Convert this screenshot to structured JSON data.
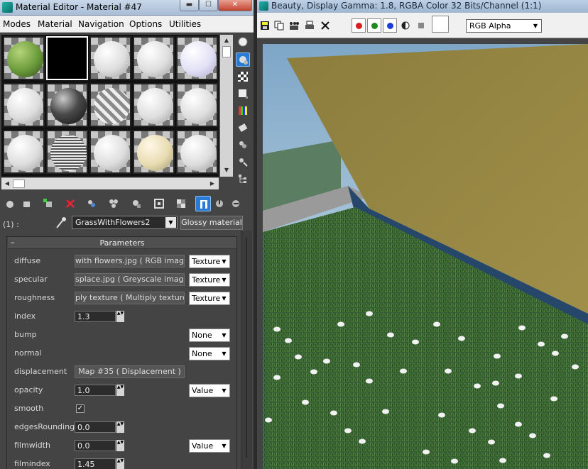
{
  "material_editor": {
    "title": "Material Editor - Material #47",
    "window_buttons": {
      "minimize": "▬",
      "maximize": "☐",
      "close": "✕"
    },
    "menu": [
      "Modes",
      "Material",
      "Navigation",
      "Options",
      "Utilities"
    ],
    "slots": [
      {
        "kind": "grass",
        "selected": false
      },
      {
        "kind": "black",
        "selected": true
      },
      {
        "kind": "white",
        "selected": false
      },
      {
        "kind": "white",
        "selected": false
      },
      {
        "kind": "lavender",
        "selected": false
      },
      {
        "kind": "white",
        "selected": false
      },
      {
        "kind": "dark",
        "selected": false
      },
      {
        "kind": "checker",
        "selected": false
      },
      {
        "kind": "white",
        "selected": false
      },
      {
        "kind": "white",
        "selected": false
      },
      {
        "kind": "white",
        "selected": false
      },
      {
        "kind": "striped",
        "selected": false
      },
      {
        "kind": "white",
        "selected": false
      },
      {
        "kind": "cream",
        "selected": false
      },
      {
        "kind": "white",
        "selected": false
      }
    ],
    "slot_label": "(1) :",
    "material_name": "GrassWithFlowers2",
    "material_type": "Glossy material",
    "rollout": {
      "toggle": "–",
      "title": "Parameters"
    },
    "params": {
      "diffuse": {
        "label": "diffuse",
        "map": "with flowers.jpg  ( RGB image )",
        "mode": "Texture"
      },
      "specular": {
        "label": "specular",
        "map": "splace.jpg  ( Greyscale image )",
        "mode": "Texture"
      },
      "roughness": {
        "label": "roughness",
        "map": "ply texture  ( Multiply texture )",
        "mode": "Texture"
      },
      "index": {
        "label": "index",
        "value": "1.3"
      },
      "bump": {
        "label": "bump",
        "mode": "None"
      },
      "normal": {
        "label": "normal",
        "mode": "None"
      },
      "displacement": {
        "label": "displacement",
        "map": "Map #35  ( Displacement )"
      },
      "opacity": {
        "label": "opacity",
        "value": "1.0",
        "mode": "Value"
      },
      "smooth": {
        "label": "smooth",
        "check": "✓"
      },
      "edgesRounding": {
        "label": "edgesRounding",
        "value": "0.0"
      },
      "filmwidth": {
        "label": "filmwidth",
        "value": "0.0",
        "mode": "Value"
      },
      "filmindex": {
        "label": "filmindex",
        "value": "1.45"
      }
    }
  },
  "frame_buffer": {
    "title": "Beauty, Display Gamma: 1.8, RGBA Color 32 Bits/Channel (1:1)",
    "channels": {
      "red": "#d81e1e",
      "green": "#1c8a1c",
      "blue": "#1e3ed8"
    },
    "channel_mode": "RGB Alpha"
  },
  "arrows": {
    "down": "▼",
    "up": "▲",
    "left": "◀",
    "right": "▶",
    "spin": "▲▼"
  },
  "icons": [
    "sphere-icon",
    "backlight-icon",
    "background-checker-icon",
    "sample-uv-icon",
    "video-color-check-icon",
    "make-preview-icon",
    "options-icon",
    "select-by-material-icon",
    "navigator-icon",
    "eyedropper-icon",
    "save-icon",
    "copy-icon",
    "clone-icon",
    "clear-icon",
    "close-icon"
  ]
}
